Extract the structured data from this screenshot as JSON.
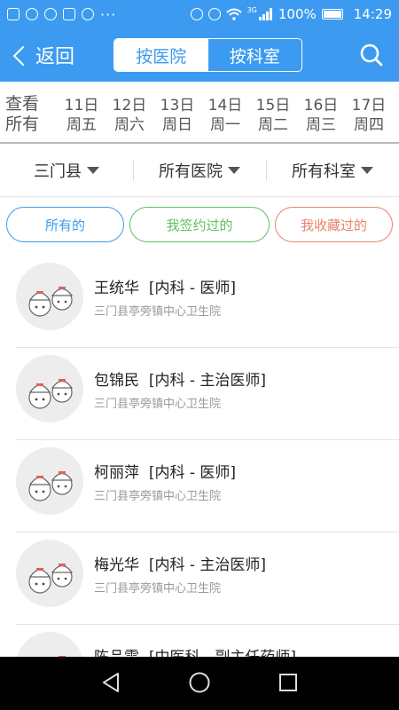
{
  "status_bar": {
    "battery": "100%",
    "time": "14:29",
    "more": "···",
    "network": "3G"
  },
  "nav": {
    "back_label": "返回",
    "segments": [
      "按医院",
      "按科室"
    ],
    "active_segment": 0
  },
  "date_bar": {
    "view_all": "查看所有",
    "days": [
      {
        "date": "11日",
        "weekday": "周五"
      },
      {
        "date": "12日",
        "weekday": "周六"
      },
      {
        "date": "13日",
        "weekday": "周日"
      },
      {
        "date": "14日",
        "weekday": "周一"
      },
      {
        "date": "15日",
        "weekday": "周二"
      },
      {
        "date": "16日",
        "weekday": "周三"
      },
      {
        "date": "17日",
        "weekday": "周四"
      }
    ]
  },
  "filters": [
    "三门县",
    "所有医院",
    "所有科室"
  ],
  "chips": [
    {
      "label": "所有的",
      "color": "#3c9bf0"
    },
    {
      "label": "我签约过的",
      "color": "#5fc05f"
    },
    {
      "label": "我收藏过的",
      "color": "#e8826b"
    }
  ],
  "doctors": [
    {
      "name": "王统华",
      "dept": "[内科 - 医师]",
      "hospital": "三门县亭旁镇中心卫生院"
    },
    {
      "name": "包锦民",
      "dept": "[内科 - 主治医师]",
      "hospital": "三门县亭旁镇中心卫生院"
    },
    {
      "name": "柯丽萍",
      "dept": "[内科 - 医师]",
      "hospital": "三门县亭旁镇中心卫生院"
    },
    {
      "name": "梅光华",
      "dept": "[内科 - 主治医师]",
      "hospital": "三门县亭旁镇中心卫生院"
    },
    {
      "name": "陈品需",
      "dept": "[中医科 - 副主任药师]",
      "hospital": ""
    }
  ],
  "colors": {
    "primary": "#3c9bf0",
    "nav_bg": "#000000"
  }
}
